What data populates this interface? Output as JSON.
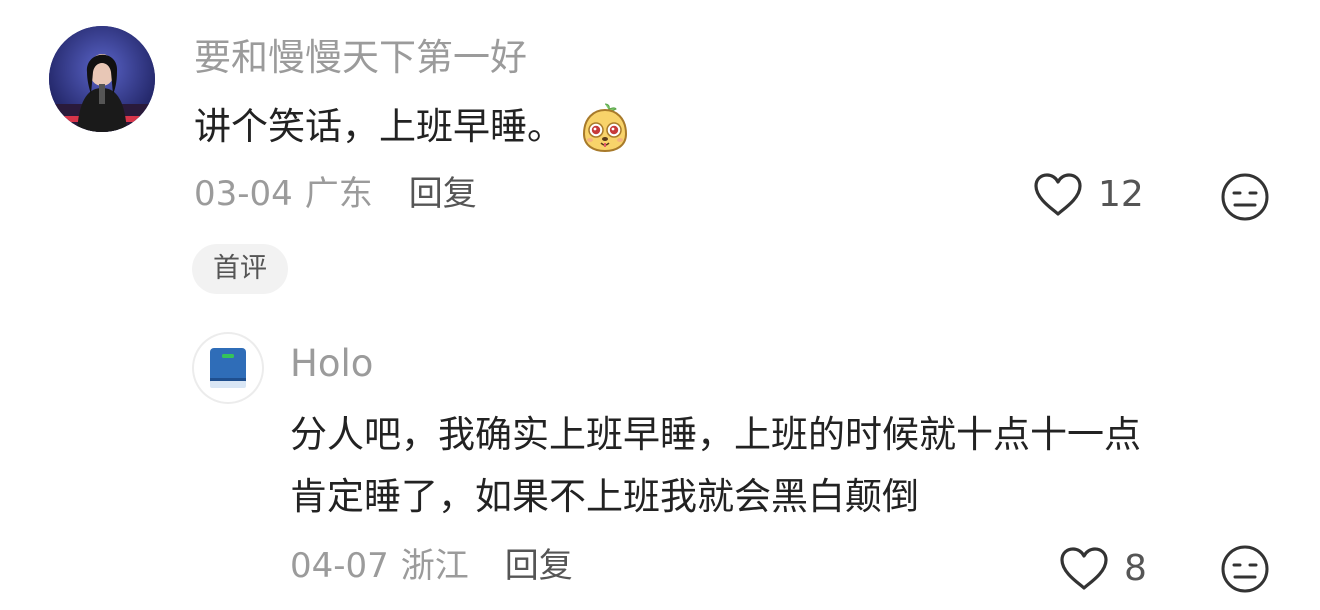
{
  "comment": {
    "username": "要和慢慢天下第一好",
    "text": "讲个笑话，上班早睡。",
    "sticker": "dog-face-sticker",
    "date": "03-04",
    "region": "广东",
    "reply_label": "回复",
    "like_count": "12",
    "badge": "首评"
  },
  "reply": {
    "username": "Holo",
    "lines": [
      "分人吧，我确实上班早睡，上班的时候就十点十一点",
      "肯定睡了，如果不上班我就会黑白颠倒"
    ],
    "date": "04-07",
    "region": "浙江",
    "reply_label": "回复",
    "like_count": "8"
  },
  "colors": {
    "meta_gray": "#9b9b9b",
    "text": "#222222",
    "icon_gray": "#333333",
    "book_blue": "#2f6db8",
    "book_green": "#34c35a"
  },
  "icons": [
    "heart-outline-icon",
    "neutral-face-icon",
    "book-icon"
  ]
}
